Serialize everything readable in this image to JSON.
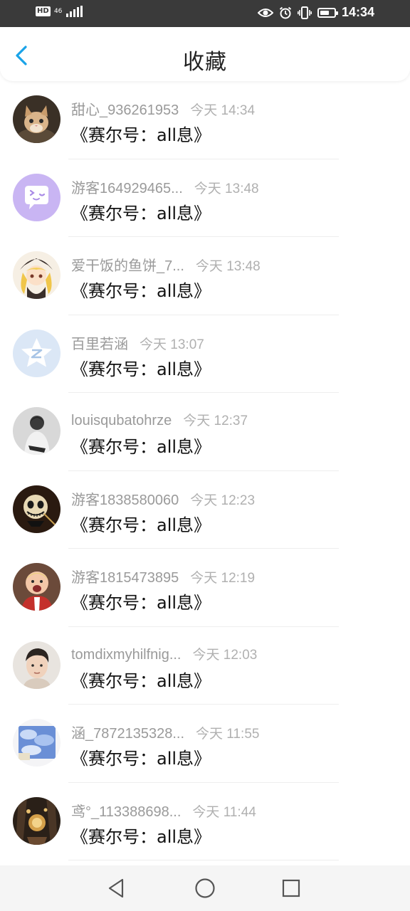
{
  "status_bar": {
    "hd": "HD",
    "network": "46",
    "time": "14:34",
    "battery_level": 0.65
  },
  "header": {
    "title": "收藏",
    "back_icon": "chevron-left-icon",
    "accent_color": "#1aa3e8"
  },
  "favorites": [
    {
      "name": "甜心_936261953",
      "time": "今天 14:34",
      "message": "《赛尔号：all息》",
      "avatar": "kitten"
    },
    {
      "name": "游客164929465...",
      "time": "今天 13:48",
      "message": "《赛尔号：all息》",
      "avatar": "purple-chat-bubble"
    },
    {
      "name": "爱干饭的鱼饼_7...",
      "time": "今天 13:48",
      "message": "《赛尔号：all息》",
      "avatar": "anime-girl"
    },
    {
      "name": "百里若涵",
      "time": "今天 13:07",
      "message": "《赛尔号：all息》",
      "avatar": "default-star"
    },
    {
      "name": "louisqubatohrze",
      "time": "今天 12:37",
      "message": "《赛尔号：all息》",
      "avatar": "grayscale-person"
    },
    {
      "name": "游客1838580060",
      "time": "今天 12:23",
      "message": "《赛尔号：all息》",
      "avatar": "jack-skellington"
    },
    {
      "name": "游客1815473895",
      "time": "今天 12:19",
      "message": "《赛尔号：all息》",
      "avatar": "shouting-child"
    },
    {
      "name": "tomdixmyhilfnig...",
      "time": "今天 12:03",
      "message": "《赛尔号：all息》",
      "avatar": "young-man"
    },
    {
      "name": "涵_7872135328...",
      "time": "今天 11:55",
      "message": "《赛尔号：all息》",
      "avatar": "blue-sky"
    },
    {
      "name": "鸢°_113388698...",
      "time": "今天 11:44",
      "message": "《赛尔号：all息》",
      "avatar": "dark-fantasy"
    }
  ],
  "nav": {
    "back": "triangle-back-icon",
    "home": "circle-home-icon",
    "recents": "square-recents-icon"
  }
}
